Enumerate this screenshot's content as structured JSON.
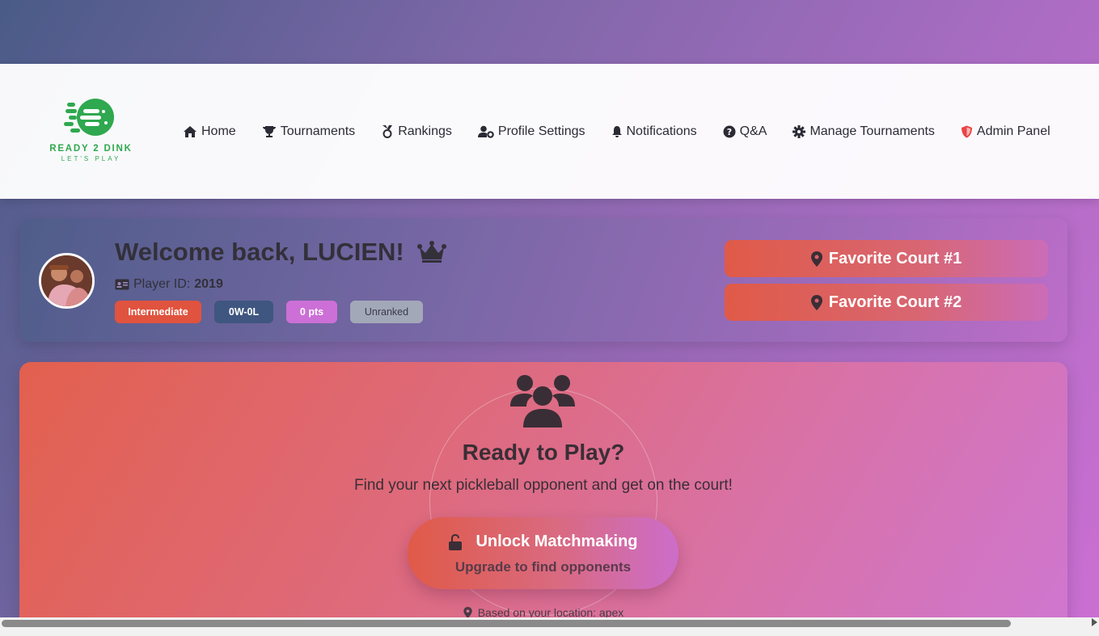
{
  "brand": {
    "name": "READY 2 DINK",
    "tagline": "LET'S PLAY",
    "color": "#2fa84f"
  },
  "nav": {
    "items": [
      {
        "label": "Home",
        "icon": "home-icon"
      },
      {
        "label": "Tournaments",
        "icon": "trophy-icon"
      },
      {
        "label": "Rankings",
        "icon": "medal-icon"
      },
      {
        "label": "Profile Settings",
        "icon": "user-cog-icon"
      },
      {
        "label": "Notifications",
        "icon": "bell-icon"
      },
      {
        "label": "Q&A",
        "icon": "question-icon"
      },
      {
        "label": "Manage Tournaments",
        "icon": "gear-icon"
      },
      {
        "label": "Admin Panel",
        "icon": "shield-icon"
      }
    ]
  },
  "welcome": {
    "greeting": "Welcome back, LUCIEN!",
    "player_id_label": "Player ID:",
    "player_id": "2019",
    "badges": [
      {
        "label": "Intermediate",
        "color": "#e0533e"
      },
      {
        "label": "0W-0L",
        "color": "#3f5680"
      },
      {
        "label": "0 pts",
        "color": "#cc6fd6"
      },
      {
        "label": "Unranked",
        "color": "#a3a8b8"
      }
    ],
    "favorite_courts": [
      "Favorite Court #1",
      "Favorite Court #2"
    ]
  },
  "play": {
    "title": "Ready to Play?",
    "subtitle": "Find your next pickleball opponent and get on the court!",
    "unlock_label": "Unlock Matchmaking",
    "unlock_sub": "Upgrade to find opponents",
    "location_text": "Based on your location: apex"
  }
}
